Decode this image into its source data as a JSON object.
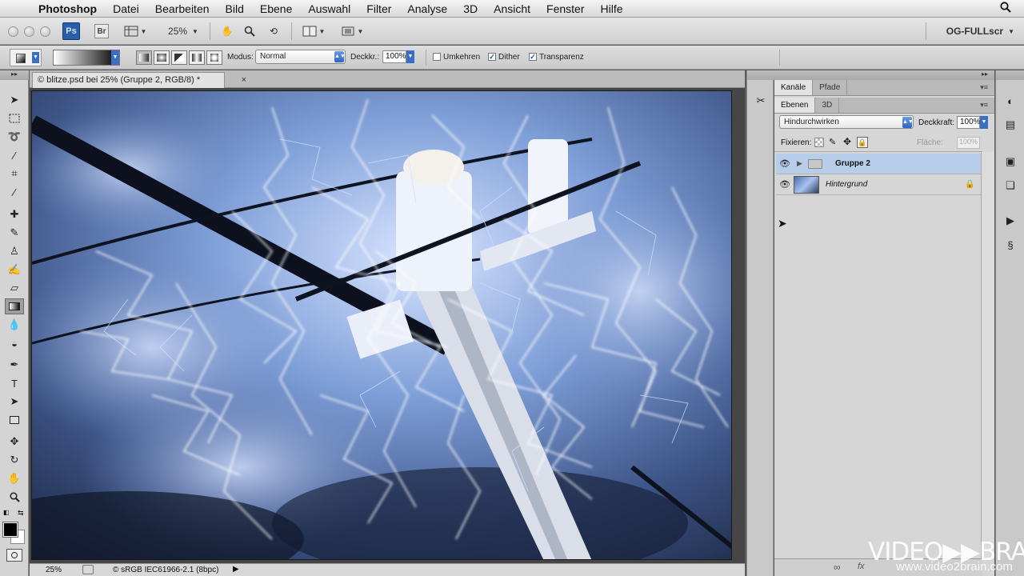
{
  "menubar": {
    "app": "Photoshop",
    "items": [
      "Datei",
      "Bearbeiten",
      "Bild",
      "Ebene",
      "Auswahl",
      "Filter",
      "Analyse",
      "3D",
      "Ansicht",
      "Fenster",
      "Hilfe"
    ]
  },
  "appbar": {
    "ps_logo": "Ps",
    "br_logo": "Br",
    "zoom": "25%",
    "workspace": "OG-FULLscr"
  },
  "options": {
    "modus_label": "Modus:",
    "modus_value": "Normal",
    "deckkr_label": "Deckkr.:",
    "deckkr_value": "100%",
    "umkehren_label": "Umkehren",
    "dither_label": "Dither",
    "dither_check": "✓",
    "transparenz_label": "Transparenz",
    "transparenz_check": "✓"
  },
  "document": {
    "tab_title": "© blitze.psd bei 25% (Gruppe 2, RGB/8) *",
    "close": "×",
    "status_zoom": "25%",
    "status_profile": "© sRGB IEC61966-2.1 (8bpc)"
  },
  "panels": {
    "top_tabs": [
      "Kanäle",
      "Pfade"
    ],
    "layer_tabs": [
      "Ebenen",
      "3D"
    ],
    "blend_mode": "Hindurchwirken",
    "deckkraft_label": "Deckkraft:",
    "deckkraft_value": "100%",
    "fixieren_label": "Fixieren:",
    "flaeche_label": "Fläche:",
    "flaeche_value": "100%",
    "layers": [
      {
        "name": "Gruppe 2",
        "type": "group",
        "selected": true
      },
      {
        "name": "Hintergrund",
        "type": "image",
        "selected": false
      }
    ]
  },
  "watermark": {
    "main": "VIDEO▶▶BRAIN",
    "sub": "www.video2brain.com"
  },
  "colors": {
    "selection": "#b7cdea",
    "ps_blue": "#2a5ea8",
    "canvas_sky": "#2d3e61"
  }
}
